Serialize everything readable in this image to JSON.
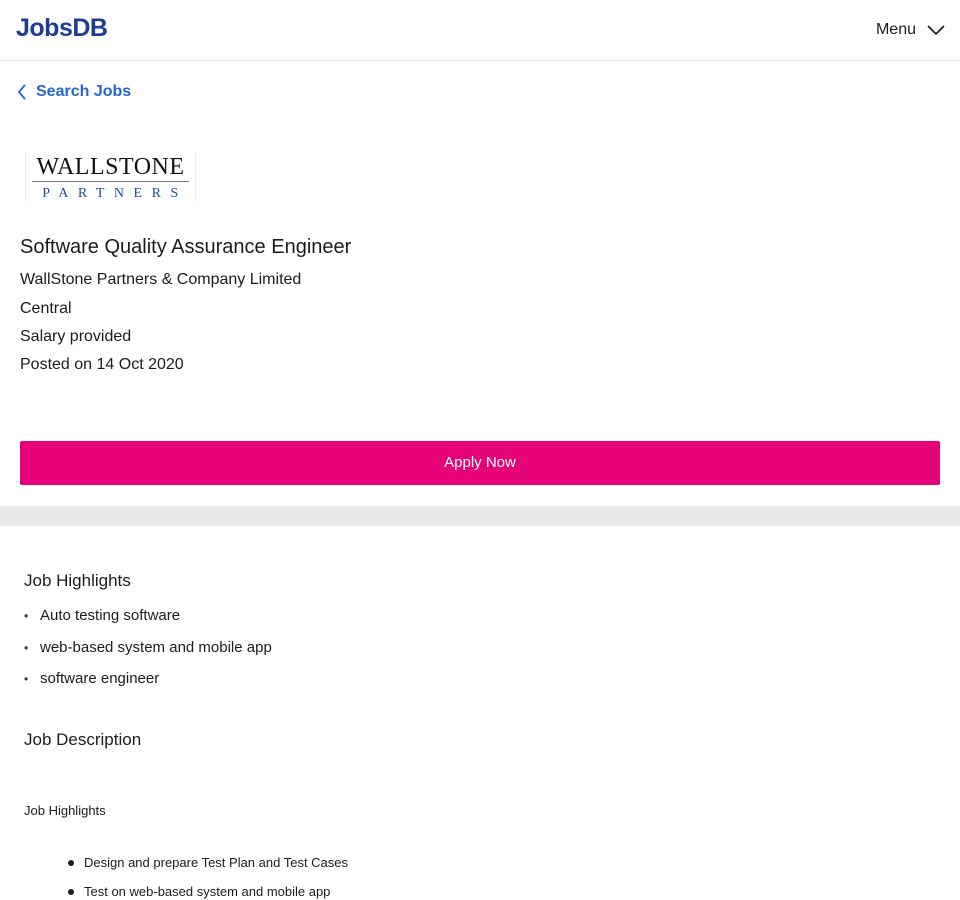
{
  "header": {
    "logo_text": "JobsDB",
    "menu_label": "Menu",
    "menu_icon": "chevron-down-icon"
  },
  "nav": {
    "back_label": "Search Jobs",
    "back_icon": "chevron-left-icon"
  },
  "company_logo": {
    "line1": "WALLSTONE",
    "line2": "PARTNERS"
  },
  "job": {
    "title": "Software Quality Assurance Engineer",
    "company": "WallStone Partners & Company Limited",
    "location": "Central",
    "salary": "Salary provided",
    "posted": "Posted on 14 Oct 2020"
  },
  "apply_label": "Apply Now",
  "colors": {
    "brand_blue": "#1c3e92",
    "link_blue": "#2765cf",
    "apply_pink": "#e60278",
    "divider_gray": "#eaeaea"
  },
  "highlights": {
    "heading": "Job Highlights",
    "items": [
      "Auto testing software",
      "web-based system and mobile app",
      "software engineer"
    ]
  },
  "description": {
    "heading": "Job Description",
    "subheading": "Job Highlights",
    "items": [
      "Design and prepare Test Plan and Test Cases",
      "Test on web-based system and mobile app"
    ]
  }
}
